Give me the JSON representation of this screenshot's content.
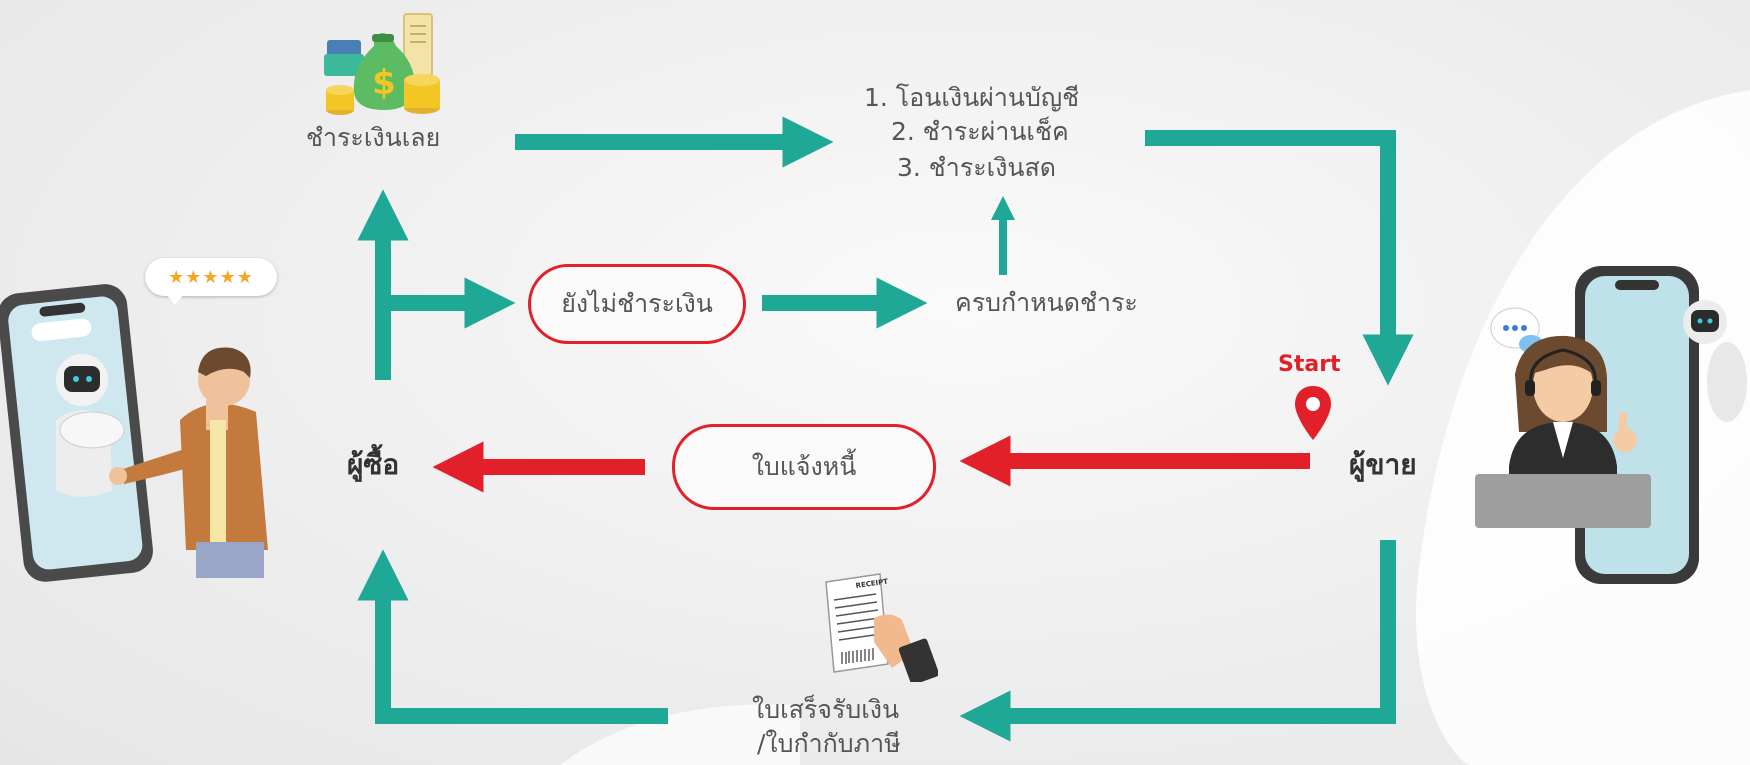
{
  "nodes": {
    "pay_now": "ชำระเงินเลย",
    "payment_methods": [
      "1. โอนเงินผ่านบัญชี",
      "2. ชำระผ่านเช็ค",
      "3. ชำระเงินสด"
    ],
    "unpaid": "ยังไม่ชำระเงิน",
    "due_date": "ครบกำหนดชำระ",
    "buyer": "ผู้ซื้อ",
    "invoice": "ใบแจ้งหนี้",
    "seller": "ผู้ขาย",
    "start": "Start",
    "receipt": [
      "ใบเสร็จรับเงิน",
      "/ใบกำกับภาษี"
    ],
    "receipt_paper": "RECEIPT",
    "rating_stars": "★★★★★"
  },
  "colors": {
    "teal_arrow": "#1fa896",
    "red_arrow": "#e2202a",
    "text": "#555555",
    "background": "#eeeeee"
  },
  "icons": [
    "money-bag-icon",
    "location-pin-icon",
    "receipt-hand-icon",
    "buyer-with-robot-phone-illustration",
    "seller-with-robot-phone-illustration",
    "rating-stars-bubble"
  ]
}
